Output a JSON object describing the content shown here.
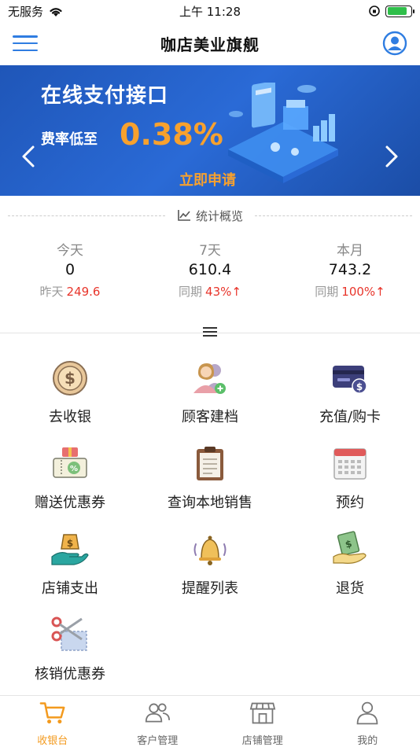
{
  "status_bar": {
    "carrier": "无服务",
    "time": "上午 11:28"
  },
  "nav": {
    "title": "咖店美业旗舰",
    "accent": "#2f7de1"
  },
  "banner": {
    "title": "在线支付接口",
    "subtitle": "费率低至",
    "rate": "0.38%",
    "apply": "立即申请"
  },
  "stats": {
    "header": "统计概览",
    "items": [
      {
        "label": "今天",
        "value": "0",
        "compare_label": "昨天",
        "compare_value": "249.6"
      },
      {
        "label": "7天",
        "value": "610.4",
        "compare_label": "同期",
        "compare_value": "43%↑"
      },
      {
        "label": "本月",
        "value": "743.2",
        "compare_label": "同期",
        "compare_value": "100%↑"
      }
    ]
  },
  "functions": [
    {
      "label": "去收银",
      "icon": "dollar-coin-icon"
    },
    {
      "label": "顾客建档",
      "icon": "customer-add-icon"
    },
    {
      "label": "充值/购卡",
      "icon": "card-recharge-icon"
    },
    {
      "label": "赠送优惠券",
      "icon": "gift-coupon-icon"
    },
    {
      "label": "查询本地销售",
      "icon": "clipboard-icon"
    },
    {
      "label": "预约",
      "icon": "calendar-icon"
    },
    {
      "label": "店铺支出",
      "icon": "hand-money-icon"
    },
    {
      "label": "提醒列表",
      "icon": "bell-icon"
    },
    {
      "label": "退货",
      "icon": "money-return-icon"
    },
    {
      "label": "核销优惠券",
      "icon": "scissors-coupon-icon"
    }
  ],
  "tabbar": [
    {
      "label": "收银台",
      "active": true,
      "icon": "cart-icon"
    },
    {
      "label": "客户管理",
      "active": false,
      "icon": "customers-icon"
    },
    {
      "label": "店铺管理",
      "active": false,
      "icon": "store-icon"
    },
    {
      "label": "我的",
      "active": false,
      "icon": "profile-icon"
    }
  ],
  "colors": {
    "accent_orange": "#f39a1e",
    "up_red": "#e8352b",
    "banner_blue": "#2a6ad6"
  }
}
